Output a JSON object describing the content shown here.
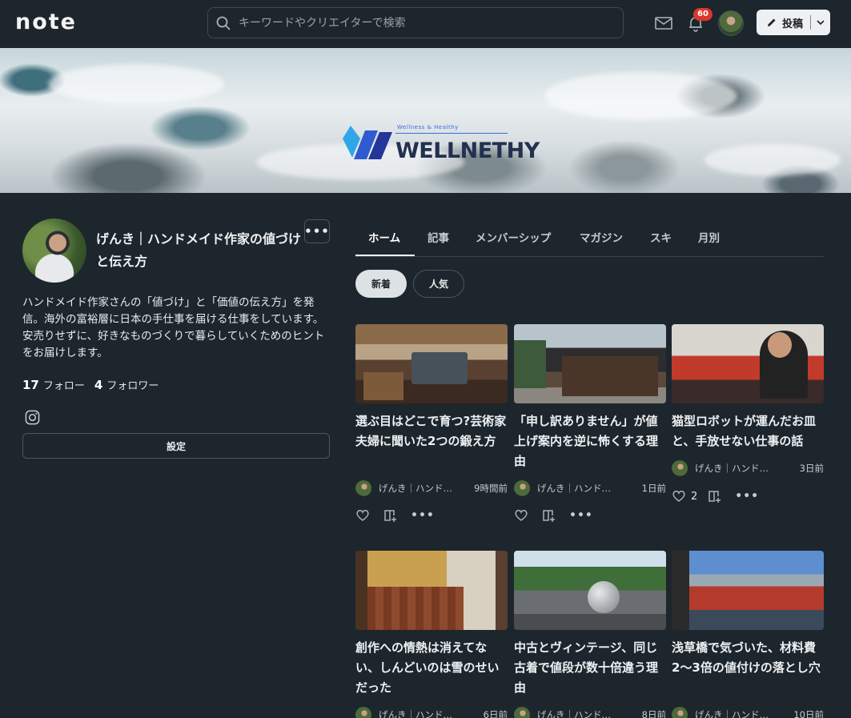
{
  "header": {
    "logo": "note",
    "search_placeholder": "キーワードやクリエイターで検索",
    "notification_count": "60",
    "post_label": "投稿"
  },
  "banner": {
    "brand": "WELLNETHY",
    "tagline": "Wellness & Healthy"
  },
  "profile": {
    "name": "げんき｜ハンドメイド作家の値づけと伝え方",
    "more": "•••",
    "bio": "ハンドメイド作家さんの「値づけ」と「価値の伝え方」を発信。海外の富裕層に日本の手仕事を届ける仕事をしています。安売りせずに、好きなものづくりで暮らしていくためのヒントをお届けします。",
    "follow_count": "17",
    "follow_label": "フォロー",
    "follower_count": "4",
    "follower_label": "フォロワー",
    "settings_label": "設定"
  },
  "tabs": [
    {
      "label": "ホーム"
    },
    {
      "label": "記事"
    },
    {
      "label": "メンバーシップ"
    },
    {
      "label": "マガジン"
    },
    {
      "label": "スキ"
    },
    {
      "label": "月別"
    }
  ],
  "filters": {
    "new": "新着",
    "popular": "人気"
  },
  "cards": [
    {
      "title": "選ぶ目はどこで育つ?芸術家夫婦に聞いた2つの鍛え方",
      "author": "げんき｜ハンドメイド作家の値づけと伝え方",
      "time": "9時間前",
      "likes": ""
    },
    {
      "title": "「申し訳ありません」が値上げ案内を逆に怖くする理由",
      "author": "げんき｜ハンドメイド作家の値づけと伝え方",
      "time": "1日前",
      "likes": ""
    },
    {
      "title": "猫型ロボットが運んだお皿と、手放せない仕事の話",
      "author": "げんき｜ハンドメイド作家の値づけと伝え方",
      "time": "3日前",
      "likes": "2"
    },
    {
      "title": "創作への情熱は消えてない、しんどいのは雪のせいだった",
      "author": "げんき｜ハンドメイド作家の値づけと伝え方",
      "time": "6日前",
      "likes": ""
    },
    {
      "title": "中古とヴィンテージ、同じ古着で値段が数十倍違う理由",
      "author": "げんき｜ハンドメイド作家の値づけと伝え方",
      "time": "8日前",
      "likes": ""
    },
    {
      "title": "浅草橋で気づいた、材料費2〜3倍の値付けの落とし穴",
      "author": "げんき｜ハンドメイド作家の値づけと伝え方",
      "time": "10日前",
      "likes": ""
    }
  ]
}
